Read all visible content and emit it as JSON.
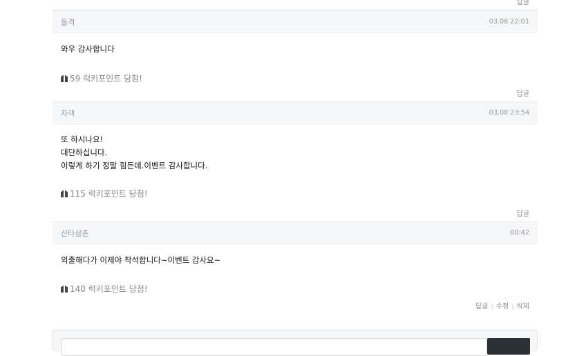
{
  "top": {
    "reply_label": "답글"
  },
  "comments": [
    {
      "author": "돌격",
      "date": "03.08 22:01",
      "lines": [
        "와우 감사합니다"
      ],
      "lucky": "59 럭키포인트 당첨!",
      "actions": [
        "답글"
      ]
    },
    {
      "author": "자객",
      "date": "03.08 23:54",
      "lines": [
        "또 하시나요!",
        "대단하십니다.",
        "이렇게 하기 정말 힘든데.이벤트 감사합니다."
      ],
      "lucky": "115 럭키포인트 당첨!",
      "actions": [
        "답글"
      ]
    },
    {
      "author": "산타삼촌",
      "date": "00:42",
      "lines": [
        "외출해다가 이제야 착석합니다~이벤트 감사요~"
      ],
      "lucky": "140 럭키포인트 당첨!",
      "actions": [
        "답글",
        "수정",
        "삭제"
      ]
    }
  ],
  "icons": {
    "lucky": "gift-icon"
  }
}
